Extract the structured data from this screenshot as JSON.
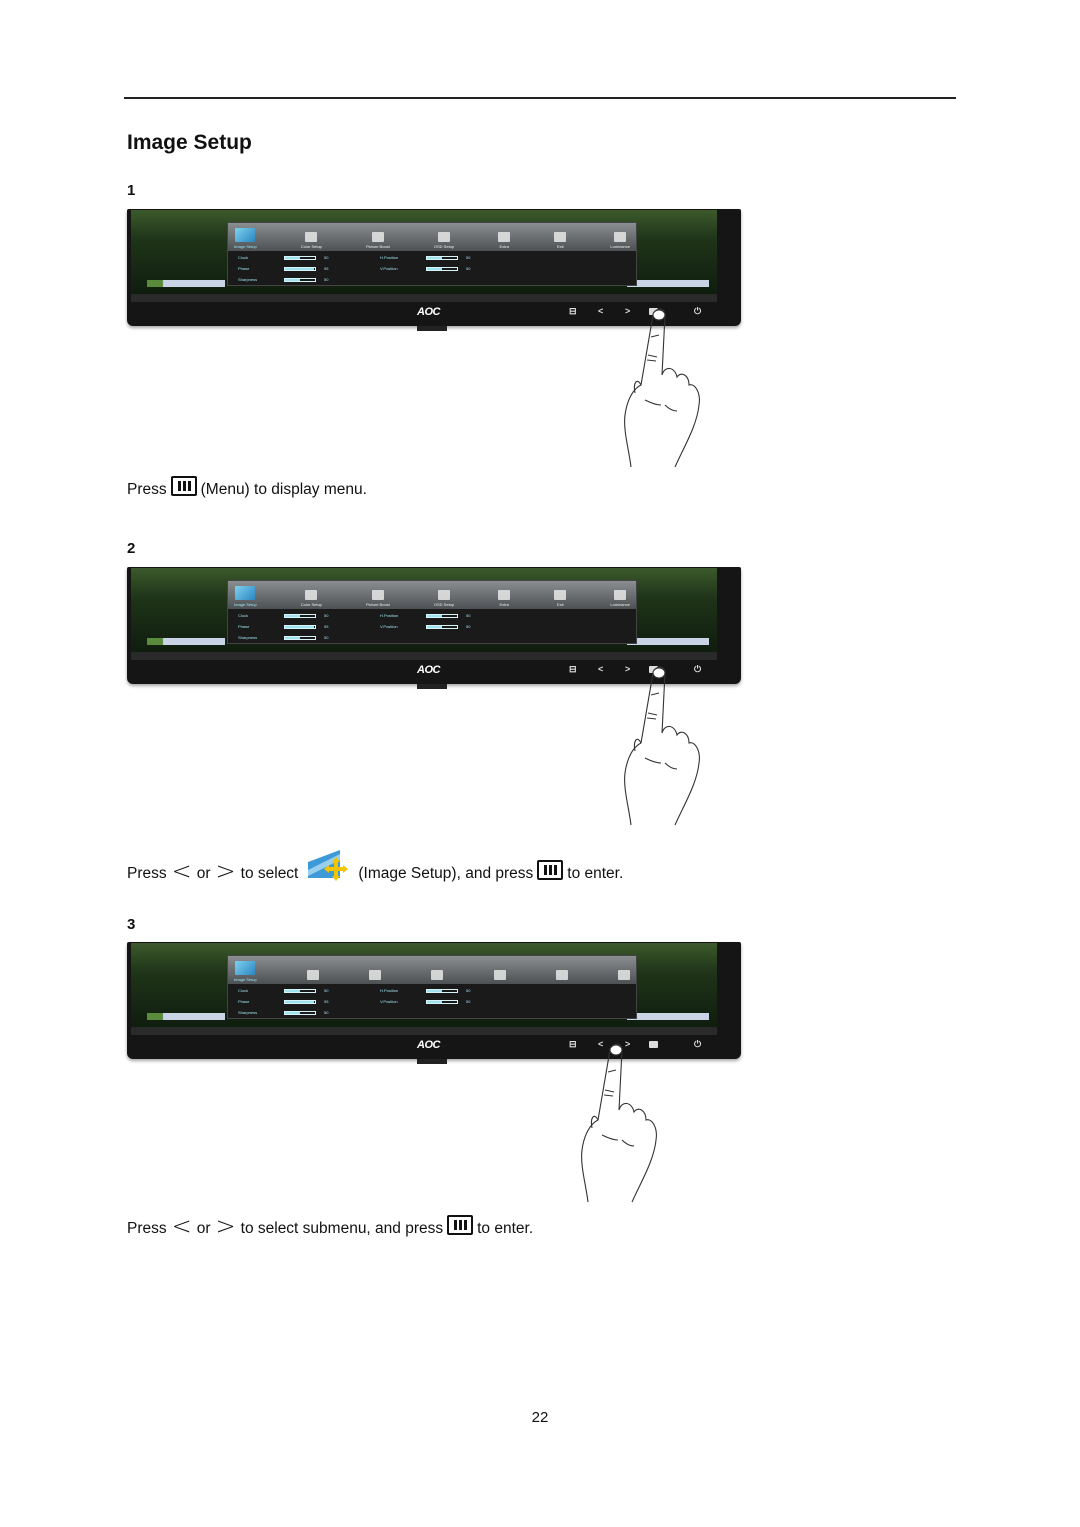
{
  "page": {
    "title": "Image Setup",
    "page_number": "22"
  },
  "steps": [
    {
      "number": "1",
      "caption": {
        "press": "Press",
        "icon": "menu-key-icon",
        "rest": "(Menu) to display menu."
      },
      "finger_on": "menu-button"
    },
    {
      "number": "2",
      "caption": {
        "press": "Press",
        "or": "or",
        "to_select": "to select",
        "item": "(Image Setup), and press",
        "end": "to enter."
      },
      "finger_on": "menu-button"
    },
    {
      "number": "3",
      "caption": {
        "press": "Press",
        "or": "or",
        "rest": "to select submenu, and press",
        "end": "to enter."
      },
      "finger_on": "right-button"
    }
  ],
  "glyphs": {
    "left": "<",
    "right": ">"
  },
  "monitor": {
    "brand": "AOC",
    "buttons": [
      "auto-icon",
      "<",
      ">",
      "menu-icon",
      "power-icon"
    ],
    "power_glyph": "⏻",
    "auto_glyph": "⊟",
    "osd": {
      "tabs": [
        "Image Setup",
        "Color Setup",
        "Picture Boost",
        "OSD Setup",
        "Extra",
        "Exit",
        "Luminance"
      ],
      "active_tab": "Image Setup",
      "left_items": [
        {
          "name": "Clock",
          "value": "50",
          "level": 0.5
        },
        {
          "name": "Phase",
          "value": "95",
          "level": 0.95
        },
        {
          "name": "Sharpness",
          "value": "50",
          "level": 0.5
        }
      ],
      "right_items": [
        {
          "name": "H.Position",
          "value": "50",
          "level": 0.5
        },
        {
          "name": "V.Position",
          "value": "50",
          "level": 0.5
        }
      ]
    }
  },
  "colors": {
    "osd_text": "#9fe3f0",
    "osd_active_icon": "#2a86c2",
    "text": "#111111"
  }
}
